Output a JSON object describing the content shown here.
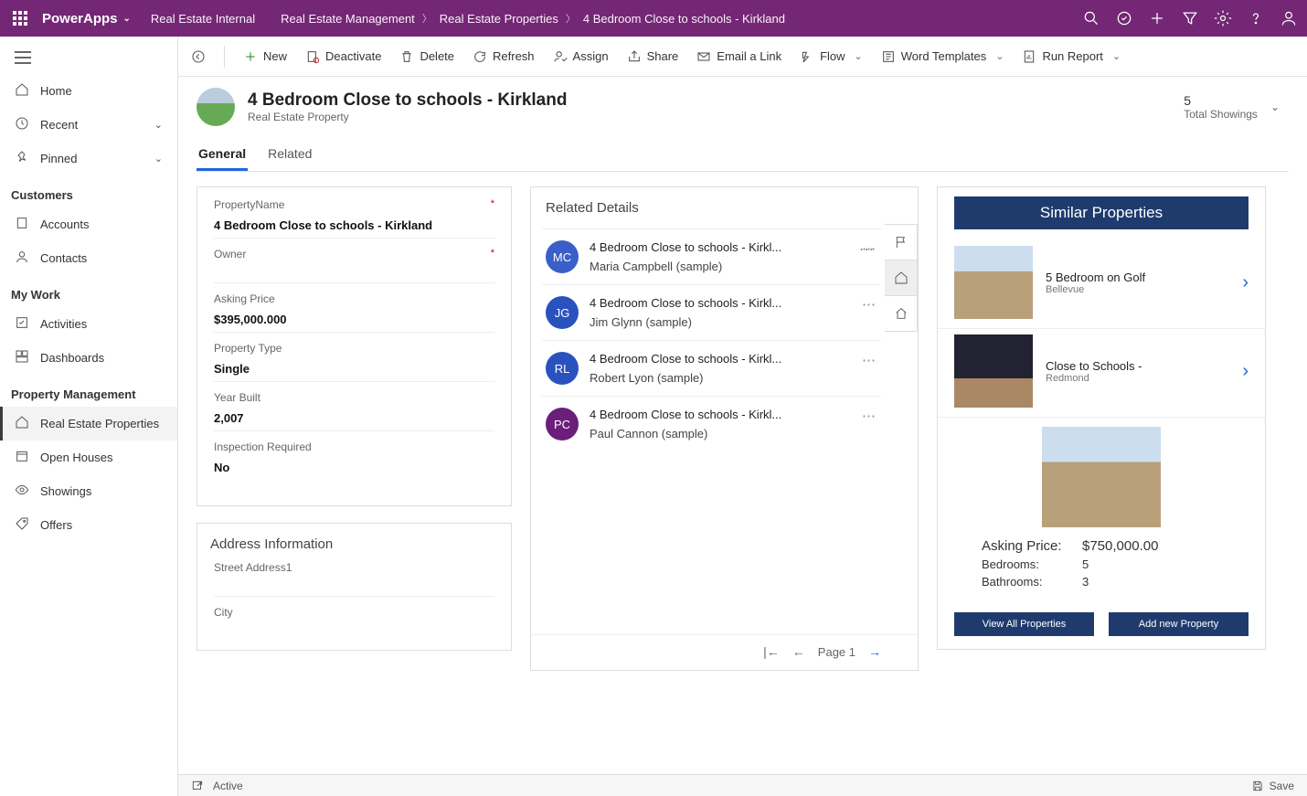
{
  "topbar": {
    "brand": "PowerApps",
    "environment": "Real Estate Internal",
    "breadcrumbs": [
      "Real Estate Management",
      "Real Estate Properties",
      "4 Bedroom Close to schools - Kirkland"
    ]
  },
  "sidebar": {
    "items": [
      {
        "label": "Home"
      },
      {
        "label": "Recent",
        "expand": true
      },
      {
        "label": "Pinned",
        "expand": true
      }
    ],
    "groups": [
      {
        "title": "Customers",
        "items": [
          {
            "label": "Accounts"
          },
          {
            "label": "Contacts"
          }
        ]
      },
      {
        "title": "My Work",
        "items": [
          {
            "label": "Activities"
          },
          {
            "label": "Dashboards"
          }
        ]
      },
      {
        "title": "Property Management",
        "items": [
          {
            "label": "Real Estate Properties",
            "active": true
          },
          {
            "label": "Open Houses"
          },
          {
            "label": "Showings"
          },
          {
            "label": "Offers"
          }
        ]
      }
    ]
  },
  "cmdbar": {
    "new": "New",
    "deactivate": "Deactivate",
    "delete": "Delete",
    "refresh": "Refresh",
    "assign": "Assign",
    "share": "Share",
    "email": "Email a Link",
    "flow": "Flow",
    "word": "Word Templates",
    "report": "Run Report"
  },
  "form": {
    "title": "4 Bedroom Close to schools - Kirkland",
    "subtitle": "Real Estate Property",
    "metric_value": "5",
    "metric_label": "Total Showings"
  },
  "tabs": {
    "general": "General",
    "related": "Related"
  },
  "fields": {
    "propertyName_label": "PropertyName",
    "propertyName_value": "4 Bedroom Close to schools - Kirkland",
    "owner_label": "Owner",
    "owner_value": "",
    "askingPrice_label": "Asking Price",
    "askingPrice_value": "$395,000.000",
    "propertyType_label": "Property Type",
    "propertyType_value": "Single",
    "yearBuilt_label": "Year Built",
    "yearBuilt_value": "2,007",
    "inspection_label": "Inspection Required",
    "inspection_value": "No"
  },
  "address": {
    "section": "Address Information",
    "street_label": "Street Address1",
    "city_label": "City"
  },
  "related": {
    "title": "Related Details",
    "items": [
      {
        "initials": "MC",
        "color": "#3b5fc9",
        "line1": "4 Bedroom Close to schools - Kirkl...",
        "line2": "Maria Campbell (sample)"
      },
      {
        "initials": "JG",
        "color": "#2a52be",
        "line1": "4 Bedroom Close to schools - Kirkl...",
        "line2": "Jim Glynn (sample)"
      },
      {
        "initials": "RL",
        "color": "#2a52be",
        "line1": "4 Bedroom Close to schools - Kirkl...",
        "line2": "Robert Lyon (sample)"
      },
      {
        "initials": "PC",
        "color": "#6b1e7a",
        "line1": "4 Bedroom Close to schools - Kirkl...",
        "line2": "Paul Cannon (sample)"
      }
    ],
    "page": "Page 1"
  },
  "similar": {
    "title": "Similar Properties",
    "items": [
      {
        "name": "5 Bedroom on Golf",
        "sub": "Bellevue"
      },
      {
        "name": "Close to Schools -",
        "sub": "Redmond"
      }
    ],
    "featured": {
      "asking_label": "Asking Price:",
      "asking_value": "$750,000.00",
      "beds_label": "Bedrooms:",
      "beds_value": "5",
      "baths_label": "Bathrooms:",
      "baths_value": "3"
    },
    "btn_viewall": "View All Properties",
    "btn_addnew": "Add new Property"
  },
  "footer": {
    "status": "Active",
    "save": "Save"
  }
}
